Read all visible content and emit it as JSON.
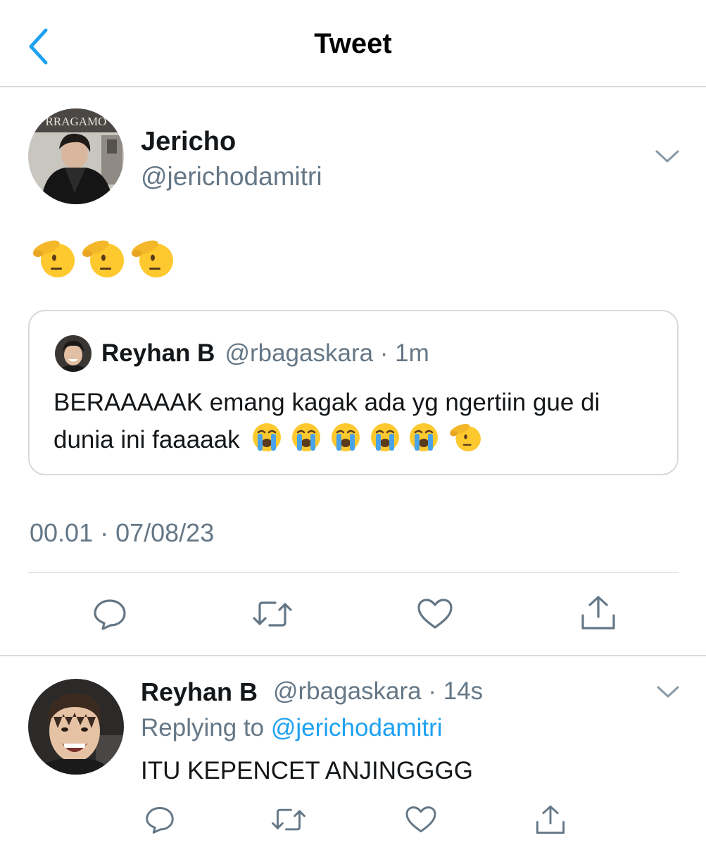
{
  "header": {
    "title": "Tweet",
    "back_icon": "chevron-left-icon"
  },
  "tweet": {
    "author": {
      "name": "Jericho",
      "handle": "@jerichodamitri",
      "avatar_text": "RRAGAMO"
    },
    "body_emojis": [
      "saluting-face",
      "saluting-face",
      "saluting-face"
    ],
    "quoted": {
      "name": "Reyhan B",
      "handle_time": "@rbagaskara · 1m",
      "text": "BERAAAAAK emang kagak ada yg ngertiin gue di dunia ini faaaaak",
      "trailing_emojis": [
        "loudly-crying-face",
        "loudly-crying-face",
        "loudly-crying-face",
        "loudly-crying-face",
        "loudly-crying-face",
        "saluting-face"
      ]
    },
    "timestamp": "00.01 · 07/08/23",
    "actions": [
      "reply-icon",
      "retweet-icon",
      "like-icon",
      "share-icon"
    ]
  },
  "reply": {
    "author": {
      "name": "Reyhan B",
      "handle_time": "@rbagaskara · 14s"
    },
    "replying_label": "Replying to",
    "replying_to": "@jerichodamitri",
    "text": "ITU KEPENCET ANJINGGGG",
    "actions": [
      "reply-icon",
      "retweet-icon",
      "like-icon",
      "share-icon"
    ]
  },
  "colors": {
    "link": "#1da1f2",
    "muted": "#657786",
    "text": "#14171a",
    "border": "#d6dade",
    "emoji": "#fdc92f"
  }
}
